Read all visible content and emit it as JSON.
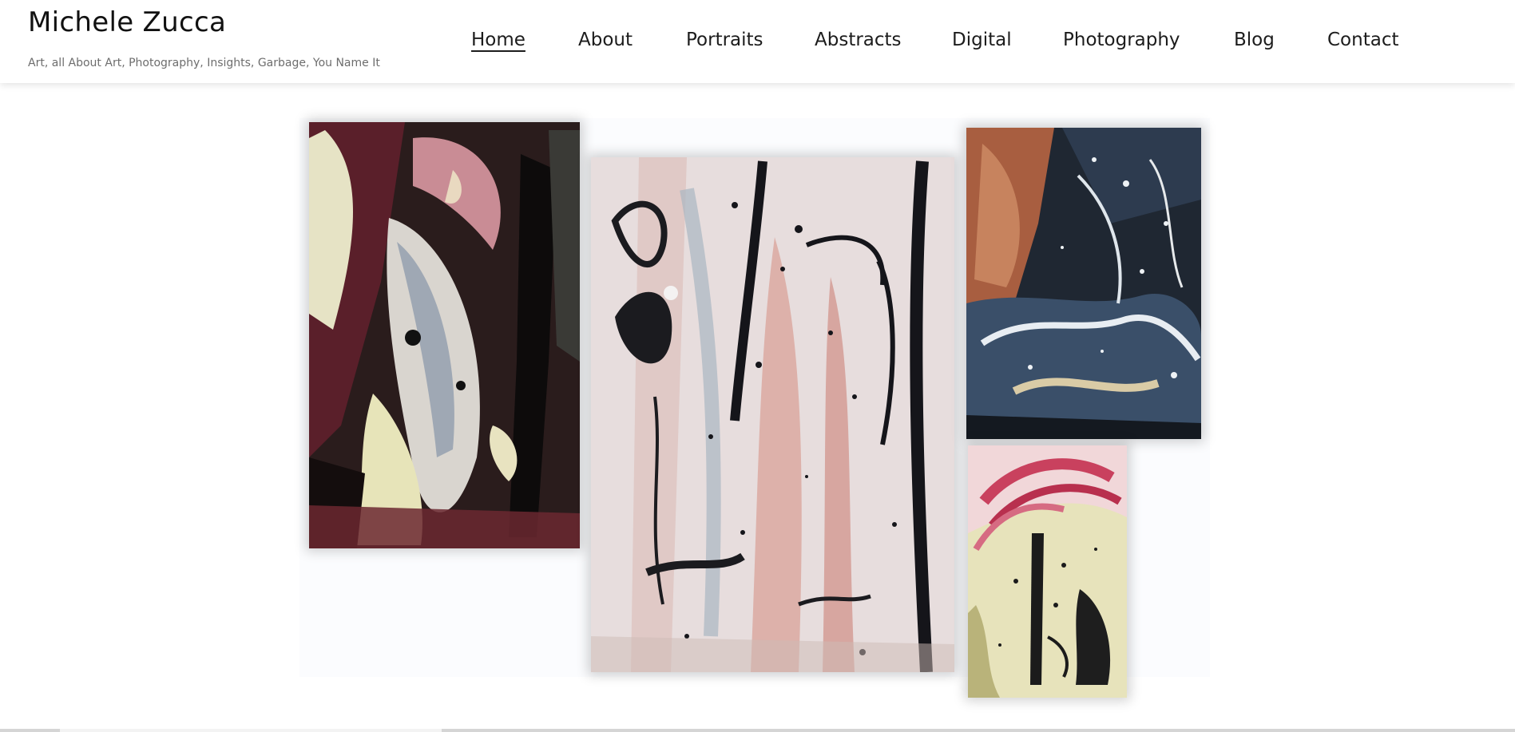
{
  "site": {
    "title": "Michele Zucca",
    "tagline": "Art, all About Art, Photography, Insights, Garbage, You Name It"
  },
  "nav": {
    "items": [
      {
        "label": "Home",
        "active": true
      },
      {
        "label": "About"
      },
      {
        "label": "Portraits"
      },
      {
        "label": "Abstracts"
      },
      {
        "label": "Digital"
      },
      {
        "label": "Photography"
      },
      {
        "label": "Blog"
      },
      {
        "label": "Contact"
      }
    ]
  },
  "gallery": {
    "paintings": [
      {
        "name": "abstract-painting-1",
        "palette": [
          "#1a1414",
          "#7a2a35",
          "#e8e6c8",
          "#c9c3b8",
          "#3b2a28"
        ]
      },
      {
        "name": "abstract-painting-2",
        "palette": [
          "#e6dcdc",
          "#d89a92",
          "#1a1a1f",
          "#9fb0c0",
          "#c8b5b2"
        ]
      },
      {
        "name": "abstract-painting-3",
        "palette": [
          "#1d2430",
          "#b86a4a",
          "#e9ecef",
          "#3e5670",
          "#d6c3a0"
        ]
      },
      {
        "name": "abstract-painting-4",
        "palette": [
          "#e8e4b8",
          "#c9435f",
          "#1a1a1a",
          "#b9b37a",
          "#f2d7d8"
        ]
      }
    ]
  },
  "colors": {
    "background": "#ffffff",
    "text": "#1c1c1c",
    "tagline": "#6d6d6d"
  }
}
